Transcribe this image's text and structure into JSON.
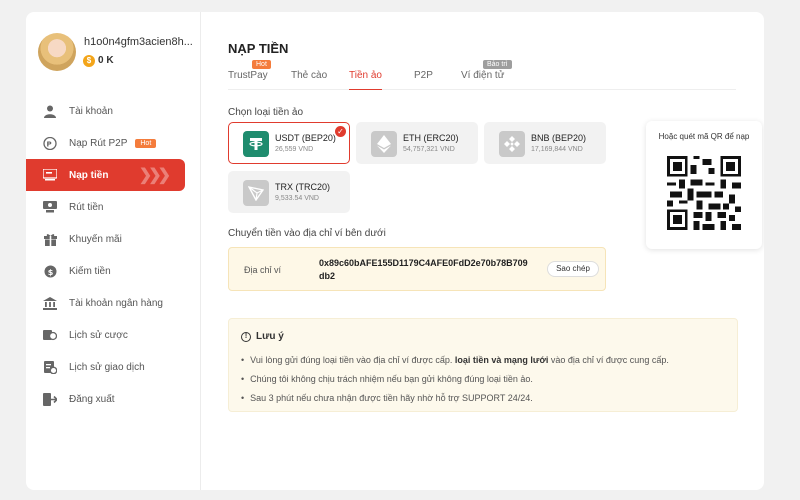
{
  "user": {
    "username": "h1o0n4gfm3acien8h...",
    "balance": "0 K",
    "coin_symbol": "$"
  },
  "menu": [
    {
      "label": "Tài khoản",
      "icon": "user-icon"
    },
    {
      "label": "Nạp Rút P2P",
      "icon": "p2p-icon",
      "badge": "Hot"
    },
    {
      "label": "Nạp tiền",
      "icon": "deposit-icon",
      "active": true
    },
    {
      "label": "Rút tiền",
      "icon": "withdraw-icon"
    },
    {
      "label": "Khuyến mãi",
      "icon": "gift-icon"
    },
    {
      "label": "Kiếm tiền",
      "icon": "money-icon"
    },
    {
      "label": "Tài khoản ngân hàng",
      "icon": "bank-icon"
    },
    {
      "label": "Lịch sử cược",
      "icon": "bet-history-icon"
    },
    {
      "label": "Lịch sử giao dịch",
      "icon": "transaction-history-icon"
    },
    {
      "label": "Đăng xuất",
      "icon": "logout-icon"
    }
  ],
  "page": {
    "title": "NẠP TIỀN",
    "tabs": [
      {
        "label": "TrustPay",
        "tag": "Hot"
      },
      {
        "label": "Thẻ cào"
      },
      {
        "label": "Tiền ảo",
        "active": true
      },
      {
        "label": "P2P"
      },
      {
        "label": "Ví điện tử",
        "tag": "Bảo trì"
      }
    ],
    "choose_label": "Chọn loại tiền ảo",
    "coins": [
      {
        "name": "USDT (BEP20)",
        "amount": "26,559 VND",
        "selected": true,
        "color": "#1f8c6e"
      },
      {
        "name": "ETH (ERC20)",
        "amount": "54,757,321 VND",
        "color": "#c9c9c9"
      },
      {
        "name": "BNB (BEP20)",
        "amount": "17,169,844 VND",
        "color": "#c9c9c9"
      },
      {
        "name": "TRX (TRC20)",
        "amount": "9,533.54 VND",
        "color": "#c9c9c9"
      }
    ],
    "qr_label": "Hoặc quét mã QR để nạp",
    "transfer_label": "Chuyển tiền vào địa chỉ ví bên dưới",
    "wallet_label": "Địa chỉ ví",
    "wallet_address": "0x89c60bAFE155D1179C4AFE0FdD2e70b78B709db2",
    "copy_button": "Sao chép",
    "note": {
      "title": "Lưu ý",
      "items": [
        {
          "prefix": "Vui lòng gửi đúng loại tiền vào địa chỉ ví được cấp. ",
          "bold": "loại tiền và mạng lưới",
          "suffix": " vào địa chỉ ví được cung cấp."
        },
        {
          "prefix": "Chúng tôi không chịu trách nhiệm nếu bạn gửi không đúng loại tiền ảo.",
          "bold": "",
          "suffix": ""
        },
        {
          "prefix": "Sau 3 phút nếu chưa nhận được tiền hãy nhờ hỗ trợ SUPPORT 24/24.",
          "bold": "",
          "suffix": ""
        }
      ]
    }
  },
  "colors": {
    "accent": "#e03b2e",
    "hot_badge": "#f47c3c",
    "maintenance_tag": "#9e9e9e"
  }
}
